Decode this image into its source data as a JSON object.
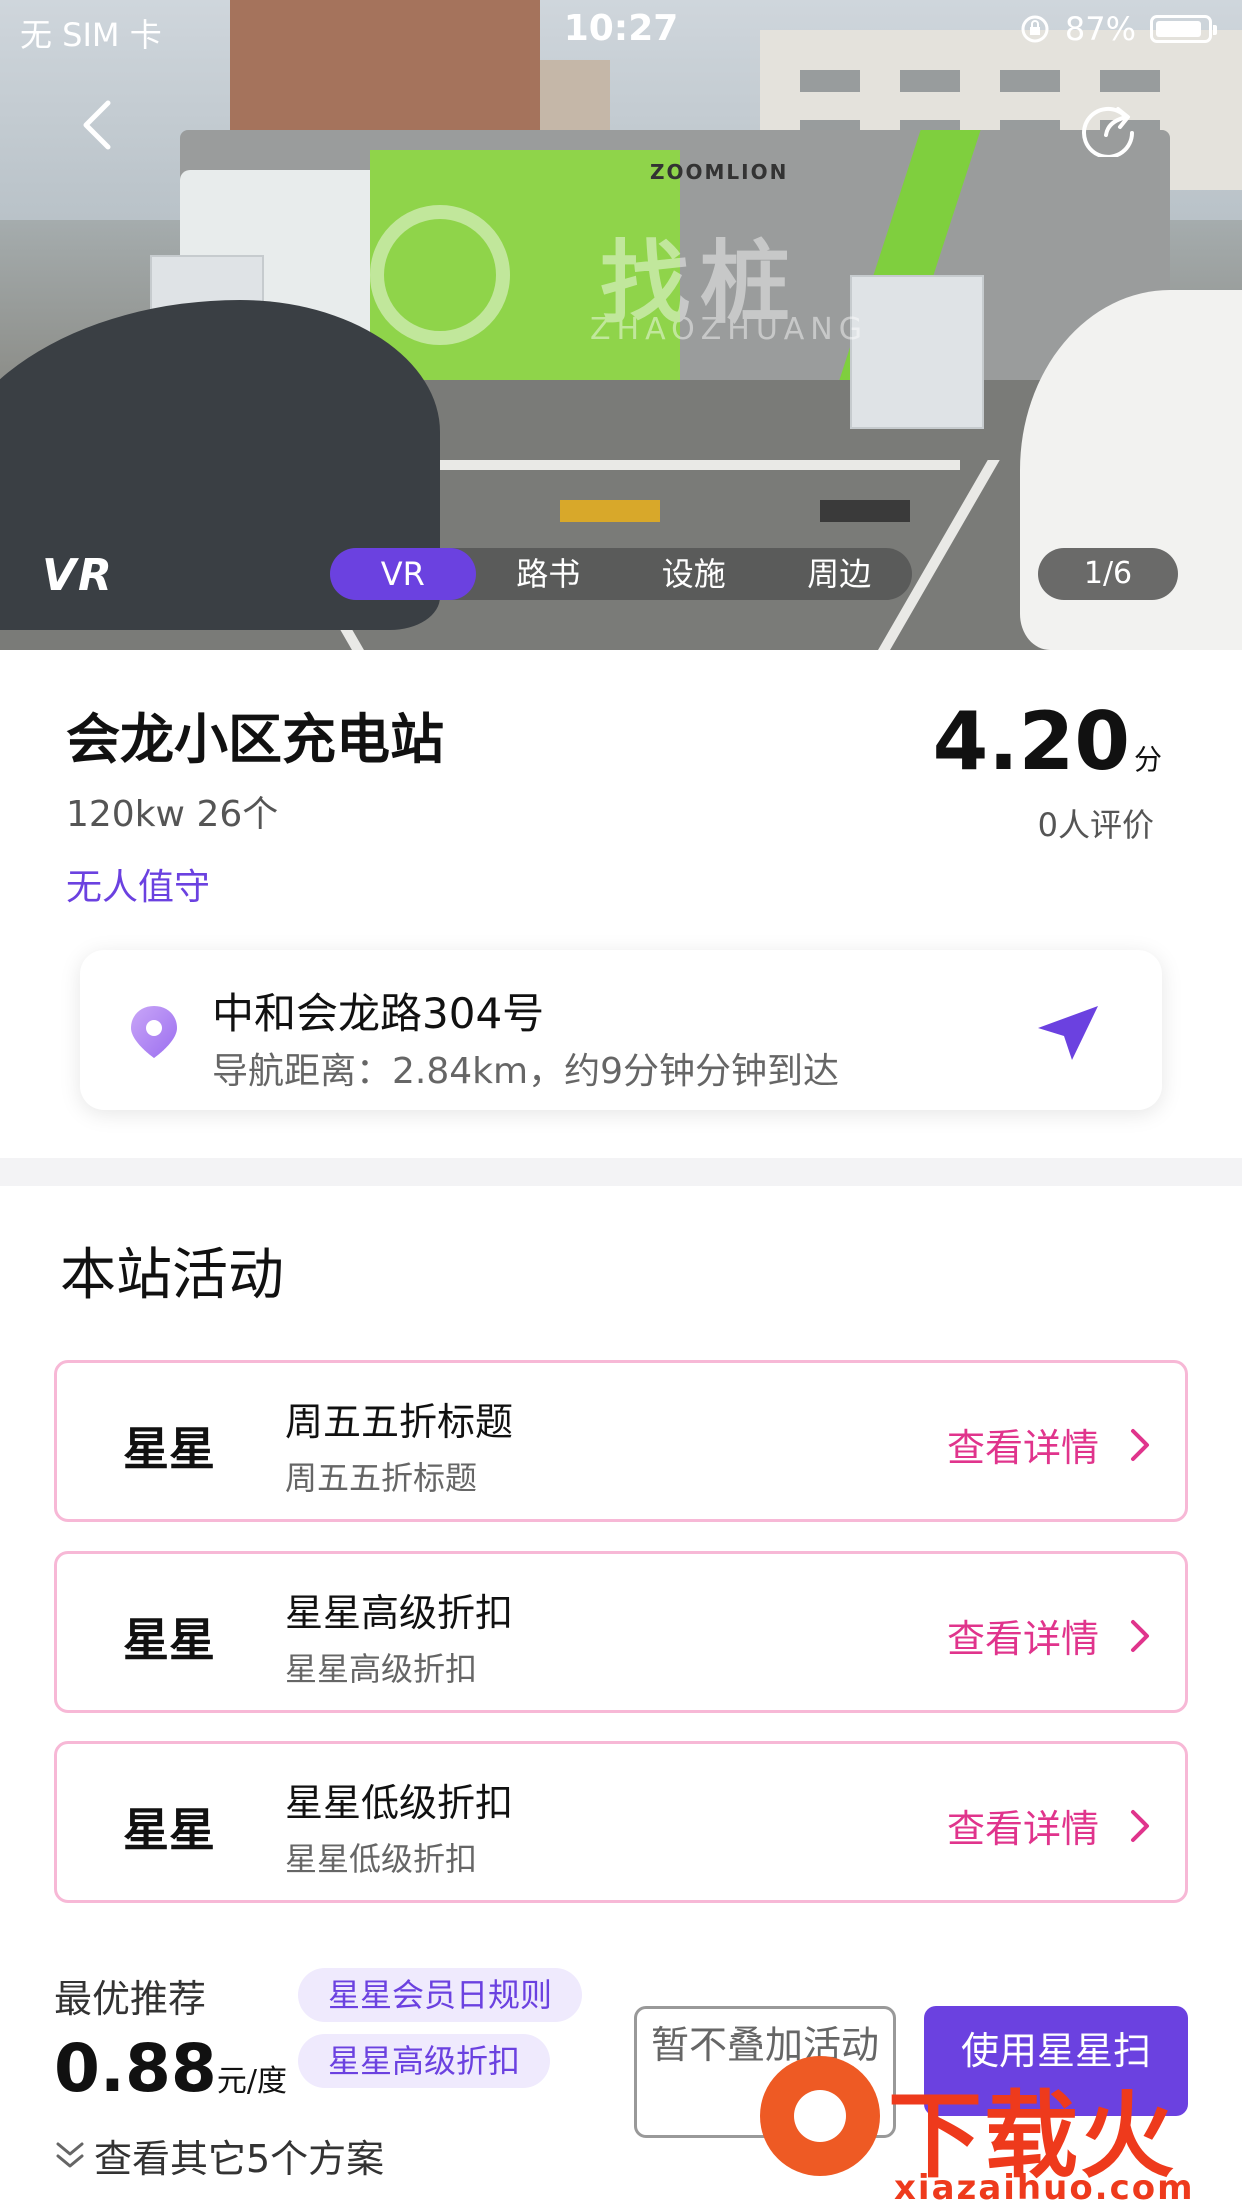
{
  "status": {
    "carrier": "无 SIM 卡",
    "time": "10:27",
    "battery": "87%"
  },
  "hero": {
    "watermark_cn": "找桩",
    "watermark_en": "ZHAOZHUANG",
    "truck_brand": "ZOOMLION",
    "vr_logo": "VR",
    "tabs": [
      "VR",
      "路书",
      "设施",
      "周边"
    ],
    "active_tab": 0,
    "page_indicator": "1/6"
  },
  "station": {
    "name": "会龙小区充电站",
    "spec": "120kw 26个",
    "attendance": "无人值守",
    "score": "4.20",
    "score_unit": "分",
    "review_count": "0人评价"
  },
  "address": {
    "line": "中和会龙路304号",
    "nav_info": "导航距离：2.84km，约9分钟分钟到达"
  },
  "activities": {
    "section_title": "本站活动",
    "link_label": "查看详情",
    "items": [
      {
        "badge": "星星",
        "title": "周五五折标题",
        "subtitle": "周五五折标题"
      },
      {
        "badge": "星星",
        "title": "星星高级折扣",
        "subtitle": "星星高级折扣"
      },
      {
        "badge": "星星",
        "title": "星星低级折扣",
        "subtitle": "星星低级折扣"
      }
    ]
  },
  "recommend": {
    "label": "最优推荐",
    "price": "0.88",
    "unit": "元/度",
    "tags": [
      "星星会员日规则",
      "星星高级折扣"
    ],
    "more_plans": "查看其它5个方案",
    "btn_nostack": "暂不叠加活动",
    "btn_use": "使用星星扫"
  },
  "site_mark": {
    "text": "下载火",
    "url": "xiazaihuo.com"
  },
  "colors": {
    "accent": "#6b41e0",
    "activity_border": "#f7b8d6",
    "link": "#e0348c"
  }
}
